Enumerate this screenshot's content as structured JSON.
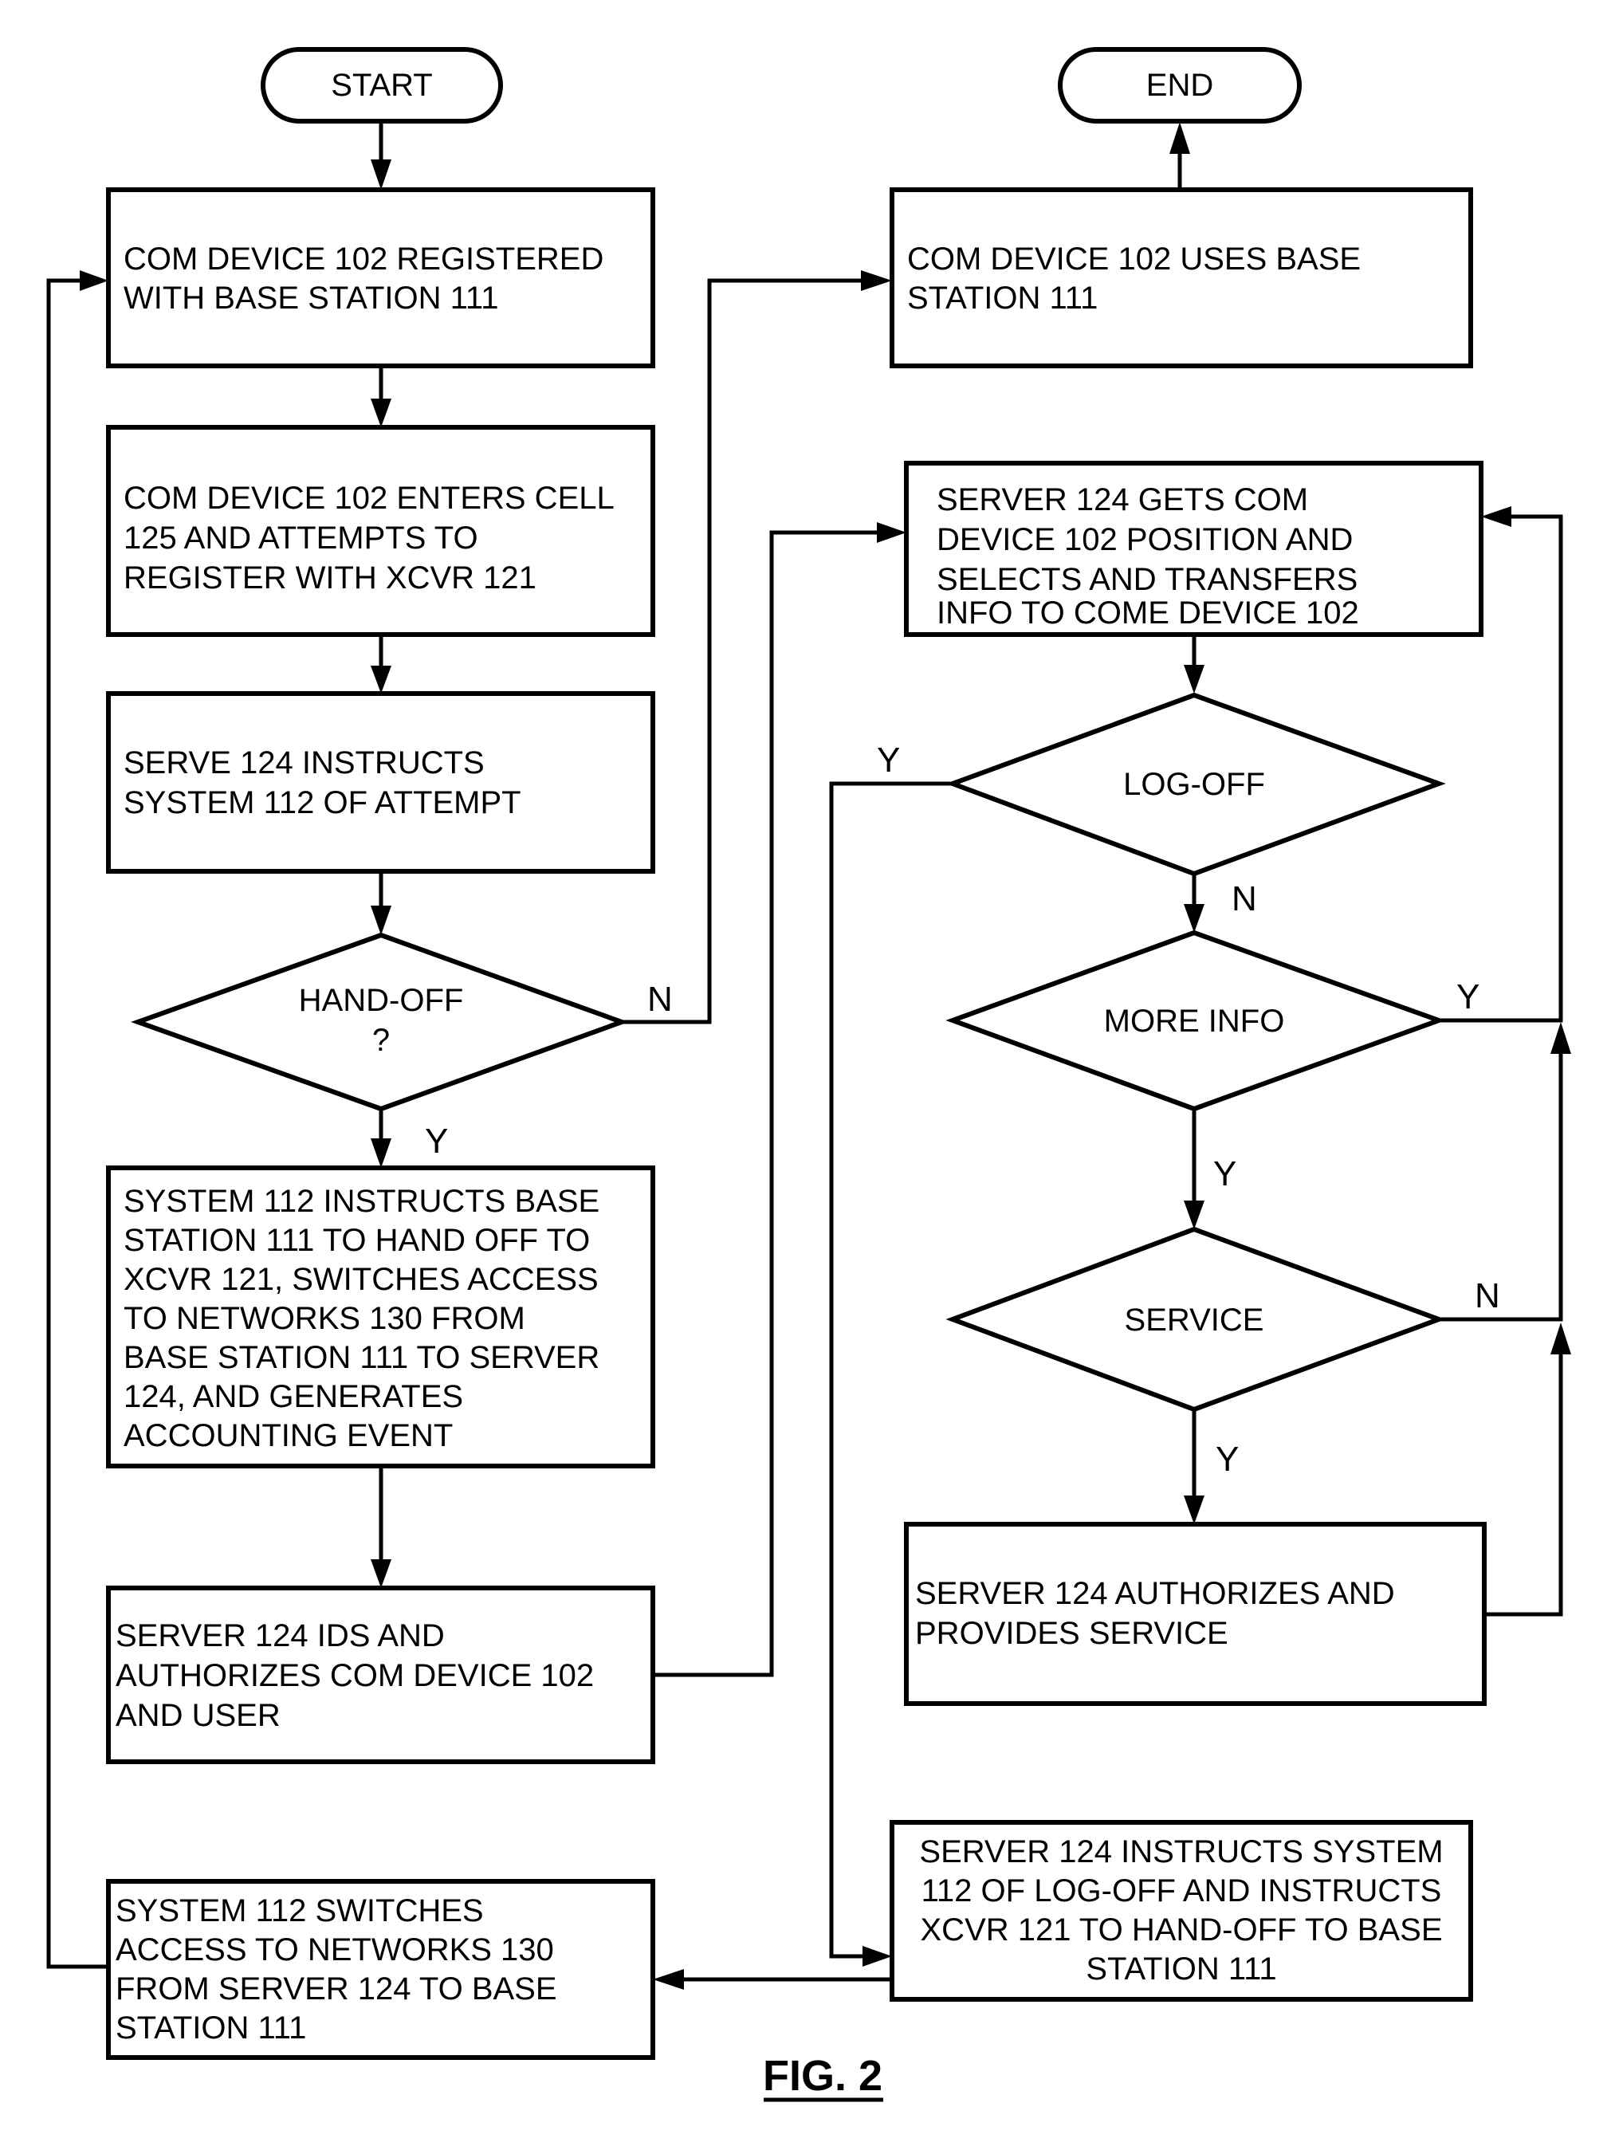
{
  "figure": {
    "caption": "FIG. 2"
  },
  "terminals": {
    "start": "START",
    "end": "END"
  },
  "left_column": {
    "registered_base": [
      "COM DEVICE 102 REGISTERED",
      "WITH BASE STATION 111"
    ],
    "enters_cell": [
      "COM DEVICE 102 ENTERS CELL",
      "125 AND ATTEMPTS TO",
      "REGISTER WITH XCVR 121"
    ],
    "serve_instructs": [
      "SERVE 124 INSTRUCTS",
      "SYSTEM 112 OF ATTEMPT"
    ],
    "handoff_decision": [
      "HAND-OFF",
      "?"
    ],
    "system_instructs_handoff": [
      "SYSTEM 112 INSTRUCTS BASE",
      "STATION 111 TO HAND OFF TO",
      "XCVR 121, SWITCHES ACCESS",
      "TO NETWORKS 130 FROM",
      "BASE STATION 111 TO SERVER",
      "124, AND GENERATES",
      "ACCOUNTING EVENT"
    ],
    "server_ids": [
      "SERVER 124 IDS AND",
      "AUTHORIZES COM DEVICE 102",
      "AND USER"
    ],
    "system_switches_back": [
      "SYSTEM 112 SWITCHES",
      "ACCESS TO NETWORKS 130",
      "FROM SERVER 124 TO BASE",
      "STATION 111"
    ]
  },
  "right_column": {
    "uses_base": [
      "COM DEVICE 102 USES BASE",
      "STATION 111"
    ],
    "server_gets_position": [
      "SERVER 124 GETS COM",
      "DEVICE 102 POSITION AND",
      "SELECTS AND TRANSFERS",
      "INFO TO COME DEVICE 102"
    ],
    "logoff_decision": "LOG-OFF",
    "more_info_decision": "MORE INFO",
    "service_decision": "SERVICE",
    "server_authorizes": [
      "SERVER 124 AUTHORIZES AND",
      "PROVIDES SERVICE"
    ],
    "server_instructs_logoff": [
      "SERVER 124 INSTRUCTS SYSTEM",
      "112 OF LOG-OFF AND INSTRUCTS",
      "XCVR 121 TO HAND-OFF TO BASE",
      "STATION 111"
    ]
  },
  "branch_labels": {
    "handoff_no": "N",
    "handoff_yes": "Y",
    "logoff_yes": "Y",
    "logoff_no": "N",
    "more_info_yes_right": "Y",
    "more_info_yes_down": "Y",
    "service_no": "N",
    "service_yes": "Y"
  }
}
